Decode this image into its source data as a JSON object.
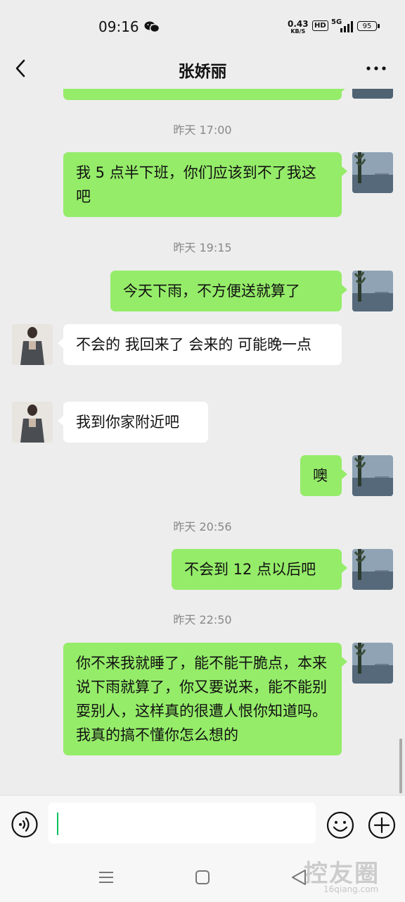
{
  "status_bar": {
    "time": "09:16",
    "net_speed_value": "0.43",
    "net_speed_unit": "KB/S",
    "hd": "HD",
    "network": "5G",
    "battery": "95"
  },
  "nav": {
    "title": "张娇丽"
  },
  "messages": [
    {
      "type": "timestamp",
      "text": "昨天 17:00"
    },
    {
      "type": "out",
      "text": "我 5 点半下班，你们应该到不了我这吧"
    },
    {
      "type": "timestamp",
      "text": "昨天 19:15"
    },
    {
      "type": "out",
      "text": "今天下雨，不方便送就算了"
    },
    {
      "type": "in",
      "text": "不会的 我回来了 会来的 可能晚一点"
    },
    {
      "type": "in",
      "text": "我到你家附近吧"
    },
    {
      "type": "out",
      "text": "噢"
    },
    {
      "type": "timestamp",
      "text": "昨天 20:56"
    },
    {
      "type": "out",
      "text": "不会到 12 点以后吧"
    },
    {
      "type": "timestamp",
      "text": "昨天 22:50"
    },
    {
      "type": "out",
      "text": "你不来我就睡了，能不能干脆点，本来说下雨就算了，你又要说来，能不能别耍别人，这样真的很遭人恨你知道吗。我真的搞不懂你怎么想的"
    }
  ],
  "input": {
    "value": ""
  },
  "watermark": {
    "main": "控友圈",
    "sub": "16qiang.com"
  },
  "colors": {
    "outgoing_bubble": "#95ec69",
    "incoming_bubble": "#ffffff",
    "background": "#ededed",
    "cursor": "#07c160"
  }
}
